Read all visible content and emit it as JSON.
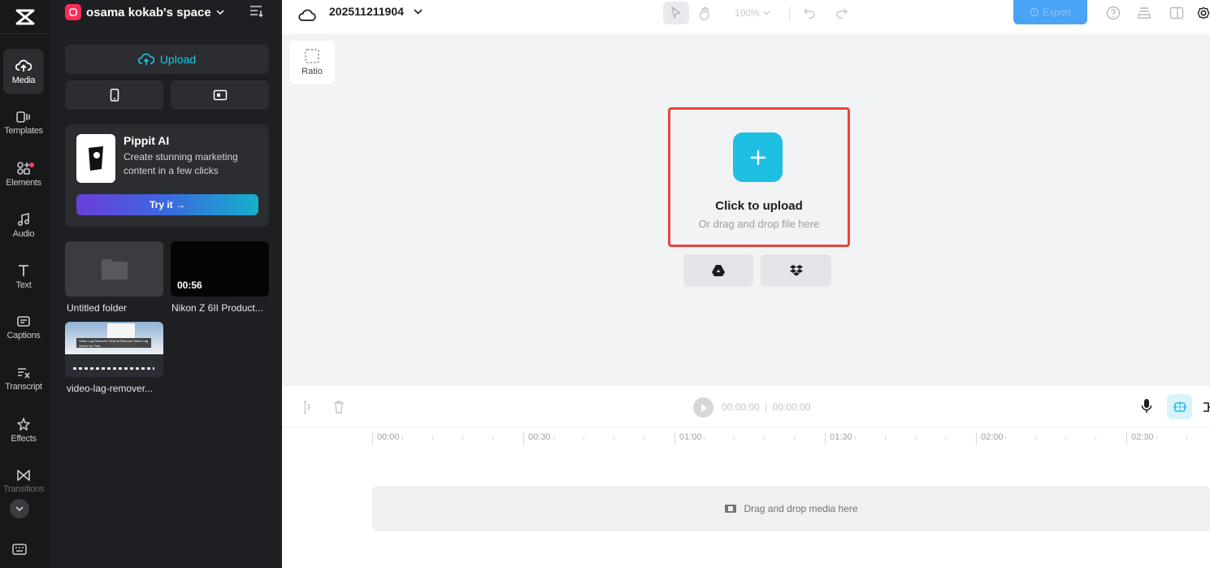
{
  "sidebar": {
    "items": [
      {
        "label": "Media",
        "icon": "cloud-upload-icon"
      },
      {
        "label": "Templates",
        "icon": "templates-icon"
      },
      {
        "label": "Elements",
        "icon": "elements-icon"
      },
      {
        "label": "Audio",
        "icon": "music-note-icon"
      },
      {
        "label": "Text",
        "icon": "text-icon"
      },
      {
        "label": "Captions",
        "icon": "captions-icon"
      },
      {
        "label": "Transcript",
        "icon": "transcript-icon"
      },
      {
        "label": "Effects",
        "icon": "effects-icon"
      },
      {
        "label": "Transitions",
        "icon": "transitions-icon"
      }
    ]
  },
  "panel": {
    "space_name": "osama kokab's space",
    "upload_label": "Upload",
    "promo": {
      "title": "Pippit AI",
      "description": "Create stunning marketing content in a few clicks",
      "button": "Try it →"
    },
    "media": [
      {
        "name": "Untitled folder",
        "kind": "folder"
      },
      {
        "name": "Nikon Z 6II Product...",
        "kind": "video",
        "duration": "00:56"
      },
      {
        "name": "video-lag-remover...",
        "kind": "video",
        "thumb_caption": "Video Lag Remover: How to Remove Video Lag Online for Free"
      }
    ]
  },
  "topbar": {
    "project_name": "202511211904",
    "zoom": "100%",
    "export_label": "Export"
  },
  "canvas": {
    "ratio_label": "Ratio",
    "upload_title": "Click to upload",
    "upload_subtitle": "Or drag and drop file here"
  },
  "timeline": {
    "current_time": "00:00:00",
    "total_time": "00:00:00",
    "ruler": [
      "00:00",
      "00:30",
      "01:00",
      "01:30",
      "02:00",
      "02:30"
    ],
    "drop_text": "Drag and drop media here"
  },
  "colors": {
    "accent": "#1fbfe4",
    "highlight_border": "#e8453a",
    "export": "#4aa3f5"
  }
}
